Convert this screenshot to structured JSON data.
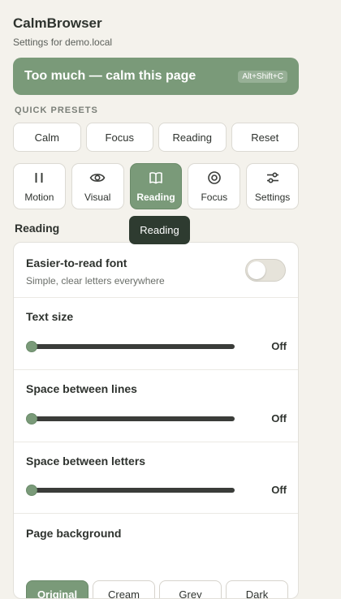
{
  "app": {
    "title": "CalmBrowser",
    "subtitle": "Settings for demo.local"
  },
  "calm_button": {
    "label": "Too much — calm this page",
    "shortcut": "Alt+Shift+C"
  },
  "presets": {
    "heading": "QUICK PRESETS",
    "items": [
      "Calm",
      "Focus",
      "Reading",
      "Reset"
    ]
  },
  "tabs": [
    {
      "label": "Motion",
      "icon": "pause-icon",
      "active": false
    },
    {
      "label": "Visual",
      "icon": "eye-icon",
      "active": false
    },
    {
      "label": "Reading",
      "icon": "book-icon",
      "active": true
    },
    {
      "label": "Focus",
      "icon": "target-icon",
      "active": false
    },
    {
      "label": "Settings",
      "icon": "sliders-icon",
      "active": false
    }
  ],
  "tooltip": "Reading",
  "panel": {
    "heading": "Reading",
    "font_toggle": {
      "title": "Easier-to-read font",
      "desc": "Simple, clear letters everywhere",
      "on": false
    },
    "text_size": {
      "title": "Text size",
      "value": "Off",
      "level": 0
    },
    "line_spacing": {
      "title": "Space between lines",
      "value": "Off",
      "level": 0
    },
    "letter_spacing": {
      "title": "Space between letters",
      "value": "Off",
      "level": 0
    },
    "background": {
      "title": "Page background",
      "options": [
        "Original",
        "Cream",
        "Grey",
        "Dark"
      ],
      "selected": "Original"
    }
  },
  "colors": {
    "accent": "#7a9a79",
    "page_bg": "#f4f2ec",
    "tooltip_bg": "#2e3b30",
    "track": "#3a3c39"
  }
}
